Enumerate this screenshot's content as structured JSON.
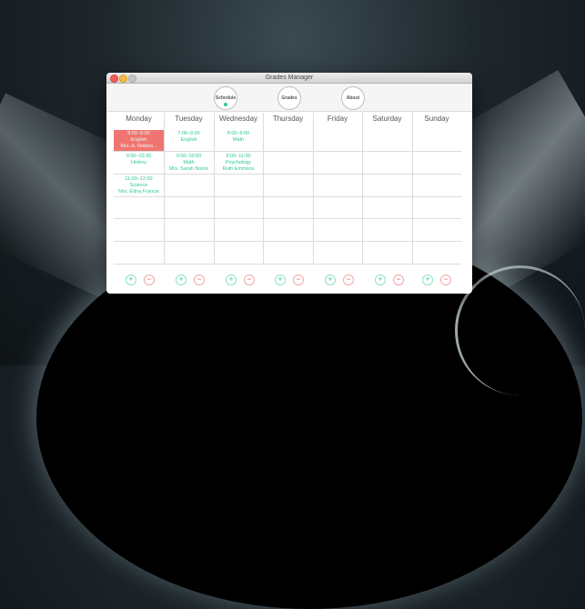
{
  "window": {
    "title": "Grades Manager"
  },
  "toolbar": {
    "tabs": [
      {
        "label": "Schedule"
      },
      {
        "label": "Grades"
      },
      {
        "label": "About"
      }
    ]
  },
  "days": [
    "Monday",
    "Tuesday",
    "Wednesday",
    "Thursday",
    "Friday",
    "Saturday",
    "Sunday"
  ],
  "schedule": {
    "monday": [
      {
        "time": "8:00–9:00",
        "subject": "English",
        "teacher": "Mrs. A. Robins..."
      },
      {
        "time": "9:00–10:30",
        "subject": "History",
        "teacher": ""
      },
      {
        "time": "11:00–12:00",
        "subject": "Science",
        "teacher": "Mrs. Edna Francis"
      }
    ],
    "tuesday": [
      {
        "time": "7:00–9:00",
        "subject": "English",
        "teacher": ""
      },
      {
        "time": "9:00–10:00",
        "subject": "Math",
        "teacher": "Mrs. Sarah Norris"
      }
    ],
    "wednesday": [
      {
        "time": "8:00–9:00",
        "subject": "Math",
        "teacher": ""
      },
      {
        "time": "9:00–11:00",
        "subject": "Psychology",
        "teacher": "Ruth Emmons"
      }
    ]
  },
  "controls": {
    "add": "+",
    "remove": "−"
  },
  "colors": {
    "accent": "#2fc79a",
    "selected": "#f07572",
    "remove": "#e45e5a"
  }
}
